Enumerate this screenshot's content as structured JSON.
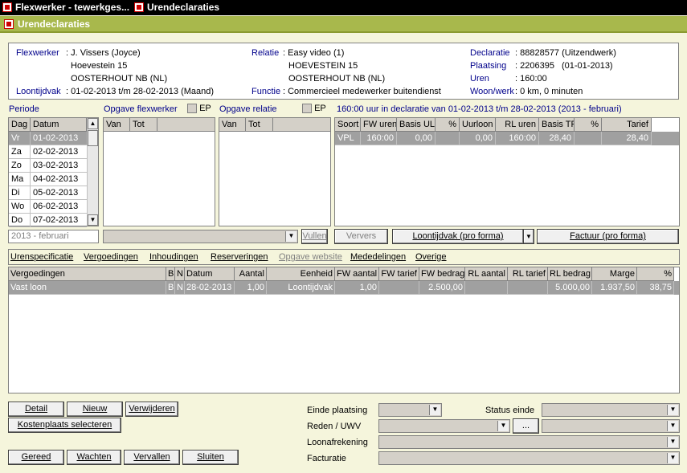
{
  "titlebar": {
    "tab1": "Flexwerker - tewerkges...",
    "tab2": "Urendeclaraties"
  },
  "subbar": {
    "title": "Urendeclaraties"
  },
  "info": {
    "flexwerker_label": "Flexwerker",
    "flexwerker_value": ": J. Vissers (Joyce)",
    "flex_addr1": "Hoevestein 15",
    "flex_addr2": "OOSTERHOUT NB (NL)",
    "loontijdvak_label": "Loontijdvak",
    "loontijdvak_value": ": 01-02-2013 t/m 28-02-2013 (Maand)",
    "relatie_label": "Relatie",
    "relatie_value": ": Easy video (1)",
    "rel_addr1": "HOEVESTEIN 15",
    "rel_addr2": "OOSTERHOUT NB (NL)",
    "functie_label": "Functie",
    "functie_value": ": Commercieel medewerker buitendienst",
    "declaratie_label": "Declaratie",
    "declaratie_value": ": 88828577 (Uitzendwerk)",
    "plaatsing_label": "Plaatsing",
    "plaatsing_value": ": 2206395",
    "plaatsing_date": "(01-01-2013)",
    "uren_label": "Uren",
    "uren_value": ": 160:00",
    "woonwerk_label": "Woon/werk",
    "woonwerk_value": ": 0 km, 0 minuten"
  },
  "periode": {
    "label": "Periode",
    "col_dag": "Dag",
    "col_datum": "Datum",
    "rows": [
      {
        "dag": "Vr",
        "datum": "01-02-2013"
      },
      {
        "dag": "Za",
        "datum": "02-02-2013"
      },
      {
        "dag": "Zo",
        "datum": "03-02-2013"
      },
      {
        "dag": "Ma",
        "datum": "04-02-2013"
      },
      {
        "dag": "Di",
        "datum": "05-02-2013"
      },
      {
        "dag": "Wo",
        "datum": "06-02-2013"
      },
      {
        "dag": "Do",
        "datum": "07-02-2013"
      }
    ],
    "month_field": "2013 - februari"
  },
  "opgave_flex": {
    "label": "Opgave flexwerker",
    "ep": "EP",
    "col_van": "Van",
    "col_tot": "Tot"
  },
  "opgave_rel": {
    "label": "Opgave relatie",
    "ep": "EP",
    "col_van": "Van",
    "col_tot": "Tot"
  },
  "vullen_btn": "Vullen",
  "decl_summary": {
    "title": "160:00 uur in declaratie van 01-02-2013 t/m 28-02-2013 (2013 - februari)",
    "cols": [
      "Soort",
      "FW uren",
      "Basis UL",
      "%",
      "Uurloon",
      "RL uren",
      "Basis TR",
      "%",
      "Tarief"
    ],
    "row": {
      "soort": "VPL",
      "fw_uren": "160:00",
      "basis_ul": "0,00",
      "pct": "",
      "uurloon": "0,00",
      "rl_uren": "160:00",
      "basis_tr": "28,40",
      "pct2": "",
      "tarief": "28,40"
    }
  },
  "ververs_btn": "Ververs",
  "loontijdvak_btn": "Loontijdvak (pro forma)",
  "factuur_btn": "Factuur (pro forma)",
  "tabs": [
    "Urenspecificatie",
    "Vergoedingen",
    "Inhoudingen",
    "Reserveringen",
    "Opgave website",
    "Mededelingen",
    "Overige"
  ],
  "verg_table": {
    "cols": [
      "Vergoedingen",
      "B",
      "N",
      "Datum",
      "Aantal",
      "Eenheid",
      "FW aantal",
      "FW tarief",
      "FW bedrag",
      "RL aantal",
      "RL tarief",
      "RL bedrag",
      "Marge",
      "%"
    ],
    "row": [
      "Vast loon",
      "B",
      "N",
      "28-02-2013",
      "1,00",
      "Loontijdvak",
      "1,00",
      "",
      "2.500,00",
      "",
      "",
      "5.000,00",
      "1.937,50",
      "38,75"
    ]
  },
  "buttons": {
    "detail": "Detail",
    "nieuw": "Nieuw",
    "verwijderen": "Verwijderen",
    "kostenplaats": "Kostenplaats selecteren",
    "gereed": "Gereed",
    "wachten": "Wachten",
    "vervallen": "Vervallen",
    "sluiten": "Sluiten",
    "dots": "..."
  },
  "form": {
    "einde_plaatsing": "Einde plaatsing",
    "status_einde": "Status einde",
    "reden": "Reden / UWV",
    "loonafrekening": "Loonafrekening",
    "facturatie": "Facturatie"
  },
  "colors": {
    "accent": "#a8b84c",
    "title": "#000000",
    "label_blue": "#00008b",
    "selected_row": "#a0a0a0"
  }
}
